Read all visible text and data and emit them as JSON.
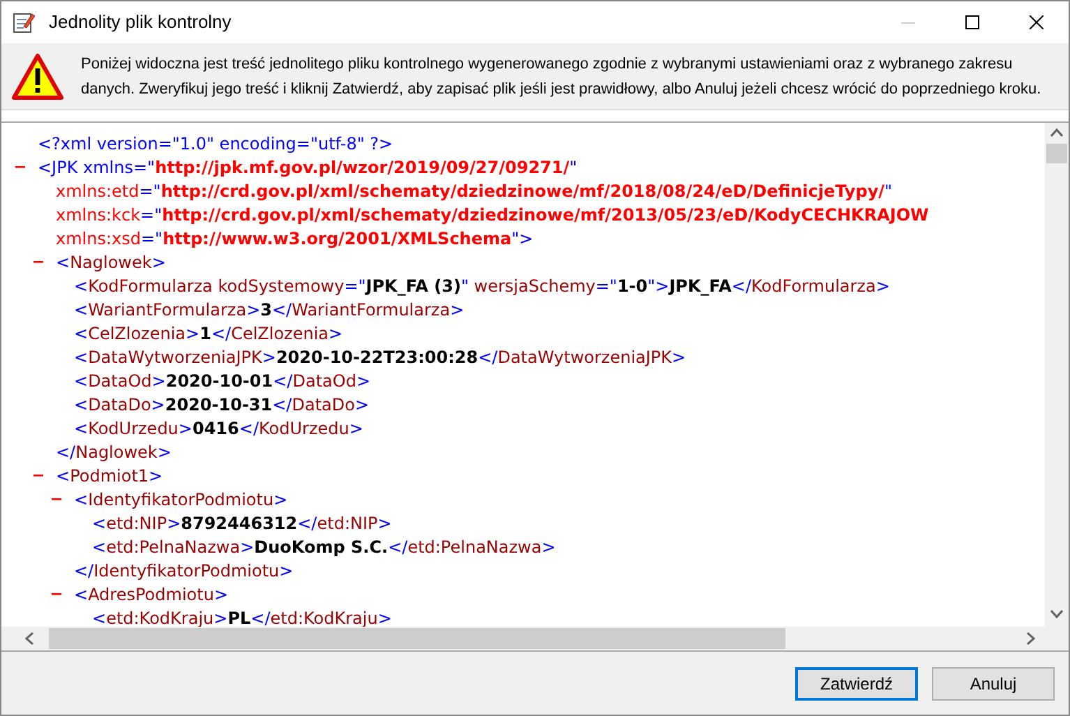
{
  "window": {
    "title": "Jednolity plik kontrolny"
  },
  "message": "Poniżej widoczna jest treść jednolitego pliku kontrolnego wygenerowanego zgodnie z wybranymi ustawieniami oraz z wybranego zakresu danych. Zweryfikuj jego treść i kliknij Zatwierdź, aby zapisać plik jeśli jest prawidłowy, albo Anuluj jeżeli chcesz wrócić do poprzedniego kroku.",
  "document": {
    "nodes": [
      {
        "lines": [
          [
            {
              "kind": "bracket",
              "text": "<?xml version=\"1.0\" encoding=\"utf-8\" ?>"
            }
          ]
        ]
      },
      {
        "expanded": true,
        "lines": [
          [
            {
              "kind": "bracket",
              "text": "<JPK xmlns=\""
            },
            {
              "kind": "attr_value",
              "text": "http://jpk.mf.gov.pl/wzor/2019/09/27/09271/"
            },
            {
              "kind": "bracket",
              "text": "\""
            }
          ],
          [
            {
              "kind": "attr",
              "text": "xmlns:etd"
            },
            {
              "kind": "bracket",
              "text": "=\""
            },
            {
              "kind": "attr_value",
              "text": "http://crd.gov.pl/xml/schematy/dziedzinowe/mf/2018/08/24/eD/DefinicjeTypy/"
            },
            {
              "kind": "bracket",
              "text": "\""
            }
          ],
          [
            {
              "kind": "attr",
              "text": "xmlns:kck"
            },
            {
              "kind": "bracket",
              "text": "=\""
            },
            {
              "kind": "attr_value",
              "text": "http://crd.gov.pl/xml/schematy/dziedzinowe/mf/2013/05/23/eD/KodyCECHKRAJOW"
            }
          ],
          [
            {
              "kind": "attr",
              "text": "xmlns:xsd"
            },
            {
              "kind": "bracket",
              "text": "=\""
            },
            {
              "kind": "attr_value",
              "text": "http://www.w3.org/2001/XMLSchema"
            },
            {
              "kind": "bracket",
              "text": "\">"
            }
          ]
        ],
        "children": [
          {
            "expanded": true,
            "lines": [
              [
                {
                  "kind": "bracket",
                  "text": "<"
                },
                {
                  "kind": "tag",
                  "text": "Naglowek"
                },
                {
                  "kind": "bracket",
                  "text": ">"
                }
              ]
            ],
            "children": [
              {
                "lines": [
                  [
                    {
                      "kind": "bracket",
                      "text": "<"
                    },
                    {
                      "kind": "tag",
                      "text": "KodFormularza kodSystemowy"
                    },
                    {
                      "kind": "bracket",
                      "text": "=\""
                    },
                    {
                      "kind": "value",
                      "text": "JPK_FA (3)"
                    },
                    {
                      "kind": "bracket",
                      "text": "\""
                    },
                    {
                      "kind": "tag",
                      "text": " wersjaSchemy"
                    },
                    {
                      "kind": "bracket",
                      "text": "=\""
                    },
                    {
                      "kind": "value",
                      "text": "1-0"
                    },
                    {
                      "kind": "bracket",
                      "text": "\">"
                    },
                    {
                      "kind": "value",
                      "text": "JPK_FA"
                    },
                    {
                      "kind": "bracket",
                      "text": "</"
                    },
                    {
                      "kind": "tag",
                      "text": "KodFormularza"
                    },
                    {
                      "kind": "bracket",
                      "text": ">"
                    }
                  ]
                ]
              },
              {
                "lines": [
                  [
                    {
                      "kind": "bracket",
                      "text": "<"
                    },
                    {
                      "kind": "tag",
                      "text": "WariantFormularza"
                    },
                    {
                      "kind": "bracket",
                      "text": ">"
                    },
                    {
                      "kind": "value",
                      "text": "3"
                    },
                    {
                      "kind": "bracket",
                      "text": "</"
                    },
                    {
                      "kind": "tag",
                      "text": "WariantFormularza"
                    },
                    {
                      "kind": "bracket",
                      "text": ">"
                    }
                  ]
                ]
              },
              {
                "lines": [
                  [
                    {
                      "kind": "bracket",
                      "text": "<"
                    },
                    {
                      "kind": "tag",
                      "text": "CelZlozenia"
                    },
                    {
                      "kind": "bracket",
                      "text": ">"
                    },
                    {
                      "kind": "value",
                      "text": "1"
                    },
                    {
                      "kind": "bracket",
                      "text": "</"
                    },
                    {
                      "kind": "tag",
                      "text": "CelZlozenia"
                    },
                    {
                      "kind": "bracket",
                      "text": ">"
                    }
                  ]
                ]
              },
              {
                "lines": [
                  [
                    {
                      "kind": "bracket",
                      "text": "<"
                    },
                    {
                      "kind": "tag",
                      "text": "DataWytworzeniaJPK"
                    },
                    {
                      "kind": "bracket",
                      "text": ">"
                    },
                    {
                      "kind": "value",
                      "text": "2020-10-22T23:00:28"
                    },
                    {
                      "kind": "bracket",
                      "text": "</"
                    },
                    {
                      "kind": "tag",
                      "text": "DataWytworzeniaJPK"
                    },
                    {
                      "kind": "bracket",
                      "text": ">"
                    }
                  ]
                ]
              },
              {
                "lines": [
                  [
                    {
                      "kind": "bracket",
                      "text": "<"
                    },
                    {
                      "kind": "tag",
                      "text": "DataOd"
                    },
                    {
                      "kind": "bracket",
                      "text": ">"
                    },
                    {
                      "kind": "value",
                      "text": "2020-10-01"
                    },
                    {
                      "kind": "bracket",
                      "text": "</"
                    },
                    {
                      "kind": "tag",
                      "text": "DataOd"
                    },
                    {
                      "kind": "bracket",
                      "text": ">"
                    }
                  ]
                ]
              },
              {
                "lines": [
                  [
                    {
                      "kind": "bracket",
                      "text": "<"
                    },
                    {
                      "kind": "tag",
                      "text": "DataDo"
                    },
                    {
                      "kind": "bracket",
                      "text": ">"
                    },
                    {
                      "kind": "value",
                      "text": "2020-10-31"
                    },
                    {
                      "kind": "bracket",
                      "text": "</"
                    },
                    {
                      "kind": "tag",
                      "text": "DataDo"
                    },
                    {
                      "kind": "bracket",
                      "text": ">"
                    }
                  ]
                ]
              },
              {
                "lines": [
                  [
                    {
                      "kind": "bracket",
                      "text": "<"
                    },
                    {
                      "kind": "tag",
                      "text": "KodUrzedu"
                    },
                    {
                      "kind": "bracket",
                      "text": ">"
                    },
                    {
                      "kind": "value",
                      "text": "0416"
                    },
                    {
                      "kind": "bracket",
                      "text": "</"
                    },
                    {
                      "kind": "tag",
                      "text": "KodUrzedu"
                    },
                    {
                      "kind": "bracket",
                      "text": ">"
                    }
                  ]
                ]
              }
            ],
            "close": [
              {
                "kind": "bracket",
                "text": "</"
              },
              {
                "kind": "tag",
                "text": "Naglowek"
              },
              {
                "kind": "bracket",
                "text": ">"
              }
            ]
          },
          {
            "expanded": true,
            "lines": [
              [
                {
                  "kind": "bracket",
                  "text": "<"
                },
                {
                  "kind": "tag",
                  "text": "Podmiot1"
                },
                {
                  "kind": "bracket",
                  "text": ">"
                }
              ]
            ],
            "children": [
              {
                "expanded": true,
                "lines": [
                  [
                    {
                      "kind": "bracket",
                      "text": "<"
                    },
                    {
                      "kind": "tag",
                      "text": "IdentyfikatorPodmiotu"
                    },
                    {
                      "kind": "bracket",
                      "text": ">"
                    }
                  ]
                ],
                "children": [
                  {
                    "lines": [
                      [
                        {
                          "kind": "bracket",
                          "text": "<"
                        },
                        {
                          "kind": "tag",
                          "text": "etd:NIP"
                        },
                        {
                          "kind": "bracket",
                          "text": ">"
                        },
                        {
                          "kind": "value",
                          "text": "8792446312"
                        },
                        {
                          "kind": "bracket",
                          "text": "</"
                        },
                        {
                          "kind": "tag",
                          "text": "etd:NIP"
                        },
                        {
                          "kind": "bracket",
                          "text": ">"
                        }
                      ]
                    ]
                  },
                  {
                    "lines": [
                      [
                        {
                          "kind": "bracket",
                          "text": "<"
                        },
                        {
                          "kind": "tag",
                          "text": "etd:PelnaNazwa"
                        },
                        {
                          "kind": "bracket",
                          "text": ">"
                        },
                        {
                          "kind": "value",
                          "text": "DuoKomp S.C."
                        },
                        {
                          "kind": "bracket",
                          "text": "</"
                        },
                        {
                          "kind": "tag",
                          "text": "etd:PelnaNazwa"
                        },
                        {
                          "kind": "bracket",
                          "text": ">"
                        }
                      ]
                    ]
                  }
                ],
                "close": [
                  {
                    "kind": "bracket",
                    "text": "</"
                  },
                  {
                    "kind": "tag",
                    "text": "IdentyfikatorPodmiotu"
                  },
                  {
                    "kind": "bracket",
                    "text": ">"
                  }
                ]
              },
              {
                "expanded": true,
                "lines": [
                  [
                    {
                      "kind": "bracket",
                      "text": "<"
                    },
                    {
                      "kind": "tag",
                      "text": "AdresPodmiotu"
                    },
                    {
                      "kind": "bracket",
                      "text": ">"
                    }
                  ]
                ],
                "children": [
                  {
                    "lines": [
                      [
                        {
                          "kind": "bracket",
                          "text": "<"
                        },
                        {
                          "kind": "tag",
                          "text": "etd:KodKraju"
                        },
                        {
                          "kind": "bracket",
                          "text": ">"
                        },
                        {
                          "kind": "value",
                          "text": "PL"
                        },
                        {
                          "kind": "bracket",
                          "text": "</"
                        },
                        {
                          "kind": "tag",
                          "text": "etd:KodKraju"
                        },
                        {
                          "kind": "bracket",
                          "text": ">"
                        }
                      ]
                    ]
                  }
                ]
              }
            ]
          }
        ]
      }
    ]
  },
  "buttons": [
    {
      "label": "Zatwierdź",
      "default": true
    },
    {
      "label": "Anuluj",
      "default": false
    }
  ]
}
